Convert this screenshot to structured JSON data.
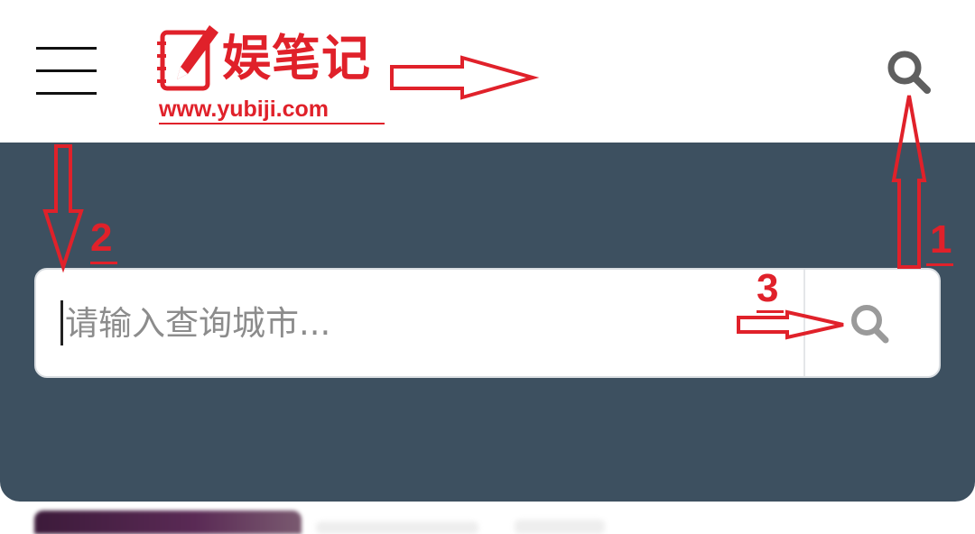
{
  "header": {
    "menu_icon": "hamburger-menu-icon",
    "logo": {
      "icon": "notebook-pencil-icon",
      "title": "娱笔记",
      "url": "www.yubiji.com"
    },
    "search_icon": "search-icon"
  },
  "hero": {
    "search": {
      "placeholder": "请输入查询城市...",
      "value": "",
      "button_icon": "search-icon"
    }
  },
  "annotations": {
    "labels": [
      "1",
      "2",
      "3"
    ]
  },
  "colors": {
    "brand_red": "#e0212a",
    "hero_bg": "#3d5060",
    "annotation_red": "#e0212a"
  }
}
